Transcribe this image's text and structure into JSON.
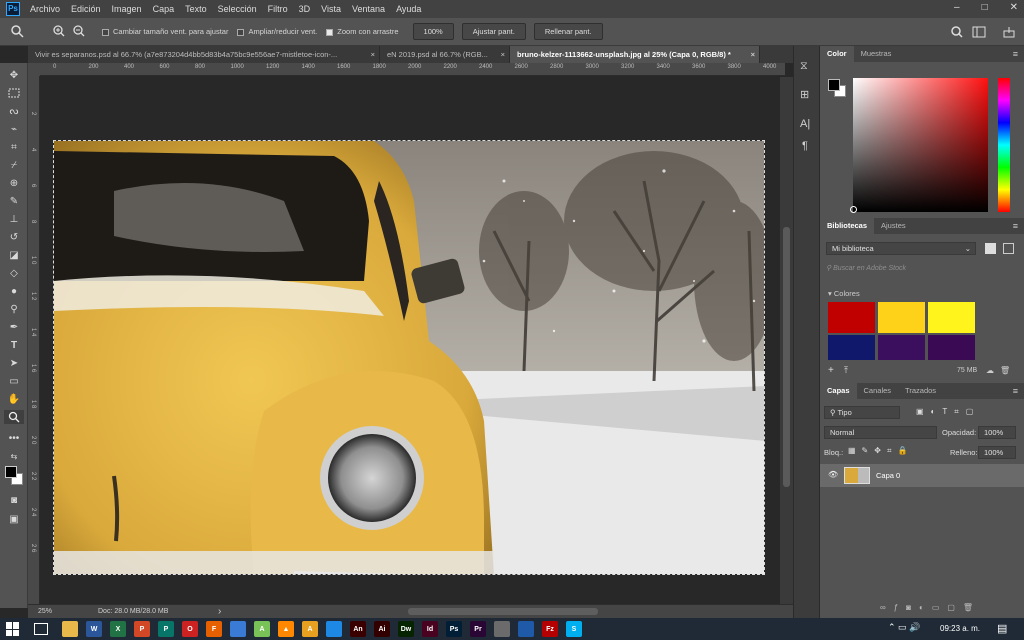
{
  "menubar": {
    "logo": "Ps",
    "items": [
      "Archivo",
      "Edición",
      "Imagen",
      "Capa",
      "Texto",
      "Selección",
      "Filtro",
      "3D",
      "Vista",
      "Ventana",
      "Ayuda"
    ],
    "window_buttons": [
      "–",
      "□",
      "✕"
    ]
  },
  "options": {
    "resize_windows": "Cambiar tamaño vent. para ajustar",
    "zoom_all": "Ampliar/reducir vent.",
    "scrubby_zoom": "Zoom con arrastre",
    "zoom_value": "100%",
    "fit_screen": "Ajustar pant.",
    "fill_screen": "Rellenar pant."
  },
  "tabs": [
    {
      "label": "Vivir es separanos.psd al 66.7% (a7e873204d4bb5d83b4a75bc9e556ae7-mistletoe-icon-...",
      "close": "×"
    },
    {
      "label": "eN 2019.psd al 66.7% (RGB...",
      "close": "×"
    },
    {
      "label": "bruno-kelzer-1113662-unsplash.jpg al 25% (Capa 0, RGB/8) *",
      "close": "×"
    }
  ],
  "ruler_h": [
    "0",
    "200",
    "400",
    "600",
    "800",
    "1000",
    "1200",
    "1400",
    "1600",
    "1800",
    "2000",
    "2200",
    "2400",
    "2600",
    "2800",
    "3000",
    "3200",
    "3400",
    "3600",
    "3800",
    "4000"
  ],
  "ruler_v": [
    "2",
    "4",
    "6",
    "8",
    "1 0",
    "1 2",
    "1 4",
    "1 6",
    "1 8",
    "2 0",
    "2 2",
    "2 4",
    "2 6"
  ],
  "status": {
    "zoom": "25%",
    "doc": "Doc: 28.0 MB/28.0 MB",
    "arrow": "›"
  },
  "color_panel": {
    "tabs": [
      "Color",
      "Muestras"
    ],
    "fg": "#000000",
    "bg": "#ffffff"
  },
  "libraries_panel": {
    "tabs": [
      "Bibliotecas",
      "Ajustes"
    ],
    "library": "Mi biblioteca",
    "search_placeholder": "Buscar en Adobe Stock",
    "section": "Colores",
    "swatches": [
      "#c00000",
      "#ffd21a",
      "#fff41c",
      "#10186b",
      "#3b0e5e",
      "#3a0a55"
    ],
    "size": "75 MB"
  },
  "layers_panel": {
    "tabs": [
      "Capas",
      "Canales",
      "Trazados"
    ],
    "filter": "Tipo",
    "blend": "Normal",
    "opacity_label": "Opacidad:",
    "opacity": "100%",
    "lock_label": "Bloq.:",
    "fill_label": "Relleno:",
    "fill": "100%",
    "layer_name": "Capa 0"
  },
  "taskbar": {
    "time": "09:23 a. m.",
    "apps": [
      {
        "label": "",
        "color": "#e8b84a"
      },
      {
        "label": "W",
        "color": "#2b579a"
      },
      {
        "label": "X",
        "color": "#217346"
      },
      {
        "label": "P",
        "color": "#d24726"
      },
      {
        "label": "P",
        "color": "#077568"
      },
      {
        "label": "O",
        "color": "#cc2222"
      },
      {
        "label": "F",
        "color": "#e66000"
      },
      {
        "label": "",
        "color": "#3a7bd5"
      },
      {
        "label": "A",
        "color": "#78c257"
      },
      {
        "label": "▲",
        "color": "#ff8800"
      },
      {
        "label": "A",
        "color": "#e8a020"
      },
      {
        "label": "",
        "color": "#1e88e5"
      },
      {
        "label": "An",
        "color": "#3a0000"
      },
      {
        "label": "Ai",
        "color": "#330000"
      },
      {
        "label": "Dw",
        "color": "#072401"
      },
      {
        "label": "Id",
        "color": "#49021f"
      },
      {
        "label": "Ps",
        "color": "#001e36"
      },
      {
        "label": "Pr",
        "color": "#2a0634"
      },
      {
        "label": "",
        "color": "#6b6b6b"
      },
      {
        "label": "",
        "color": "#1e5aa8"
      },
      {
        "label": "Fz",
        "color": "#b40000"
      },
      {
        "label": "S",
        "color": "#00aff0"
      }
    ]
  }
}
